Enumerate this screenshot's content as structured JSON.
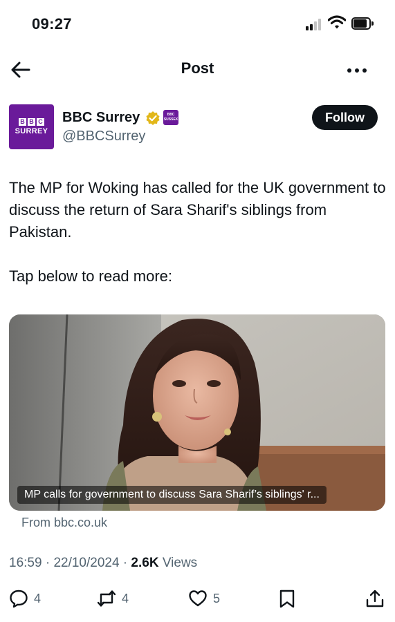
{
  "status_bar": {
    "time": "09:27"
  },
  "nav": {
    "title": "Post",
    "back_icon": "arrow-left-icon",
    "more_icon": "more-horizontal-icon"
  },
  "author": {
    "name": "BBC Surrey",
    "handle": "@BBCSurrey",
    "avatar_blocks": [
      "B",
      "B",
      "C"
    ],
    "avatar_label": "SURREY",
    "affiliate_label_top": "BBC",
    "affiliate_label_bottom": "SUSSEX",
    "verified_color": "#e2b719",
    "brand_color": "#6a1a9a"
  },
  "follow_button": {
    "label": "Follow"
  },
  "tweet": {
    "paragraph_1": "The MP for Woking has called for the UK government to discuss the return of Sara Sharif's siblings from Pakistan.",
    "paragraph_2": "Tap below to read more:"
  },
  "card": {
    "caption": "MP calls for government to discuss Sara Sharif’s siblings' r...",
    "source": "From bbc.co.uk"
  },
  "meta": {
    "time": "16:59",
    "separator_1": " · ",
    "date": "22/10/2024",
    "separator_2": " · ",
    "views_count": "2.6K",
    "views_label": " Views"
  },
  "actions": {
    "replies": "4",
    "reposts": "4",
    "likes": "5"
  }
}
